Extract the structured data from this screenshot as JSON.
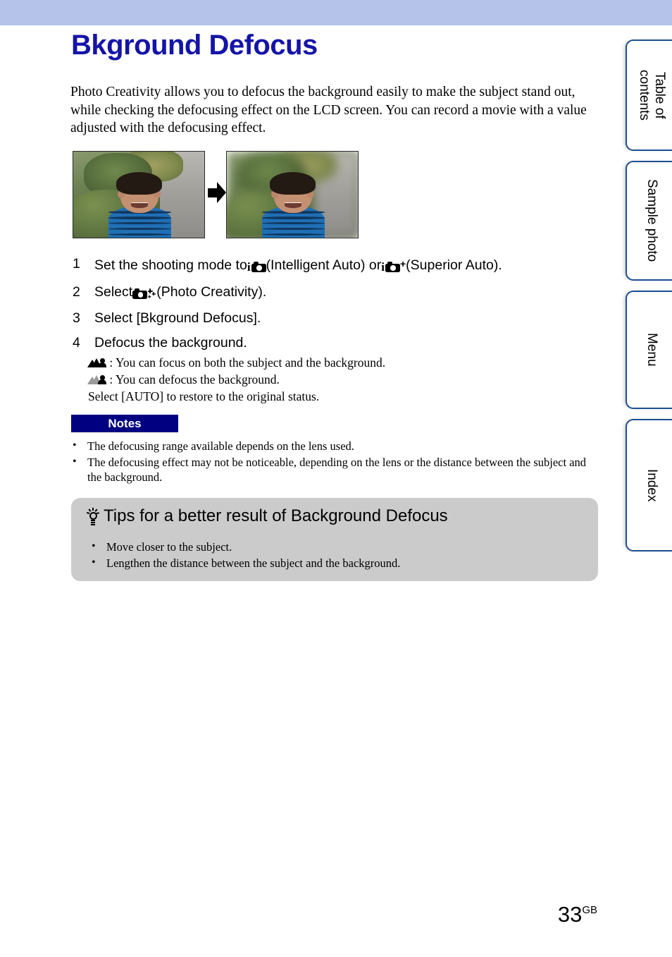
{
  "header": {
    "band_color": "#b5c3ea"
  },
  "page_title": "Bkground Defocus",
  "title_color": "#1414a8",
  "intro": "Photo Creativity allows you to defocus the background easily to make the subject stand out, while checking the defocusing effect on the LCD screen. You can record a movie with a value adjusted with the defocusing effect.",
  "figure": {
    "left_photo_alt": "boy portrait with sharp background",
    "right_photo_alt": "boy portrait with defocused background",
    "arrow": "right-arrow-icon"
  },
  "steps": [
    {
      "num": "1",
      "text_before": "Set the shooting mode to",
      "icon1": "intelligent-auto-camera-icon",
      "text_mid1": "(Intelligent Auto) or",
      "icon2": "superior-auto-camera-icon",
      "text_mid2": "(Superior Auto)."
    },
    {
      "num": "2",
      "text_before": "Select",
      "icon1": "photo-creativity-camera-icon",
      "text_mid1": "(Photo Creativity)."
    },
    {
      "num": "3",
      "text_before": "Select [Bkground Defocus]."
    },
    {
      "num": "4",
      "text_before": "Defocus the background."
    }
  ],
  "substeps": [
    {
      "icon": "mountain-person-sharp-icon",
      "text": ": You can focus on both the subject and the background."
    },
    {
      "icon": "mountain-person-blurred-icon",
      "text": ": You can defocus the background."
    }
  ],
  "substep_trailer": "Select [AUTO] to restore to the original status.",
  "notes": {
    "label": "Notes",
    "badge_bg": "#000080",
    "items": [
      "The defocusing range available depends on the lens used.",
      "The defocusing effect may not be noticeable, depending on the lens or the distance between the subject and the background."
    ]
  },
  "tips": {
    "icon": "lightbulb-icon",
    "title": "Tips for a better result of Background Defocus",
    "bg_color": "#cbcbcb",
    "items": [
      "Move closer to the subject.",
      "Lengthen the distance between the subject and the background."
    ]
  },
  "tabs": [
    {
      "label": "Table of\ncontents",
      "name": "tab-table-of-contents"
    },
    {
      "label": "Sample photo",
      "name": "tab-sample-photo"
    },
    {
      "label": "Menu",
      "name": "tab-menu"
    },
    {
      "label": "Index",
      "name": "tab-index"
    }
  ],
  "footer": {
    "page_number": "33",
    "page_suffix": "GB"
  }
}
